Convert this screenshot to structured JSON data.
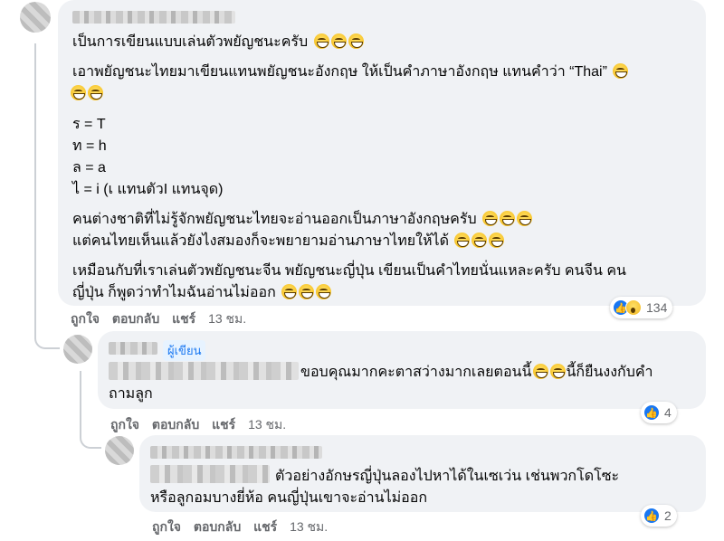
{
  "main_comment": {
    "lines": [
      "เป็นการเขียนแบบเล่นตัวพยัญชนะครับ",
      "เอาพยัญชนะไทยมาเขียนแทนพยัญชนะอังกฤษ ให้เป็นคำภาษาอังกฤษ แทนคำว่า “Thai”",
      "ร = T",
      "ท = h",
      "ล = a",
      "ไ = i (เ แทนตัวI แทนจุด)",
      "คนต่างชาติที่ไม่รู้จักพยัญชนะไทยจะอ่านออกเป็นภาษาอังกฤษครับ",
      "แต่คนไทยเห็นแล้วยังไงสมองก็จะพยายามอ่านภาษาไทยให้ได้",
      "เหมือนกับที่เราเล่นตัวพยัญชนะจีน พยัญชนะญี่ปุ่น เขียนเป็นคำไทยนั่นแหละครับ คนจีน คน",
      "ญี่ปุ่น ก็พูดว่าทำไมฉันอ่านไม่ออก"
    ],
    "actions": {
      "like": "ถูกใจ",
      "reply": "ตอบกลับ",
      "share": "แชร์",
      "time": "13 ชม."
    },
    "reaction_count": "134"
  },
  "reply1": {
    "author_badge": "ผู้เขียน",
    "lines": [
      "ขอบคุณมากคะตาสว่างมากเลยตอนนี้",
      "นี้ก็ยืนงงกับคำ",
      "ถามลูก"
    ],
    "actions": {
      "like": "ถูกใจ",
      "reply": "ตอบกลับ",
      "share": "แชร์",
      "time": "13 ชม."
    },
    "reaction_count": "4"
  },
  "reply2": {
    "lines": [
      "ตัวอย่างอักษรญี่ปุ่นลองไปหาได้ในเซเว่น เช่นพวกโดโซะ",
      "หรือลูกอมบางยี่ห้อ คนญี่ปุ่นเขาจะอ่านไม่ออก"
    ],
    "actions": {
      "like": "ถูกใจ",
      "reply": "ตอบกลับ",
      "share": "แชร์",
      "time": "13 ชม."
    },
    "reaction_count": "2"
  },
  "colors": {
    "bubble": "#f0f2f5",
    "action_text": "#65676b",
    "like_blue": "#1877f2"
  },
  "icons": [
    "grin-emoji",
    "like-icon",
    "wow-icon"
  ]
}
